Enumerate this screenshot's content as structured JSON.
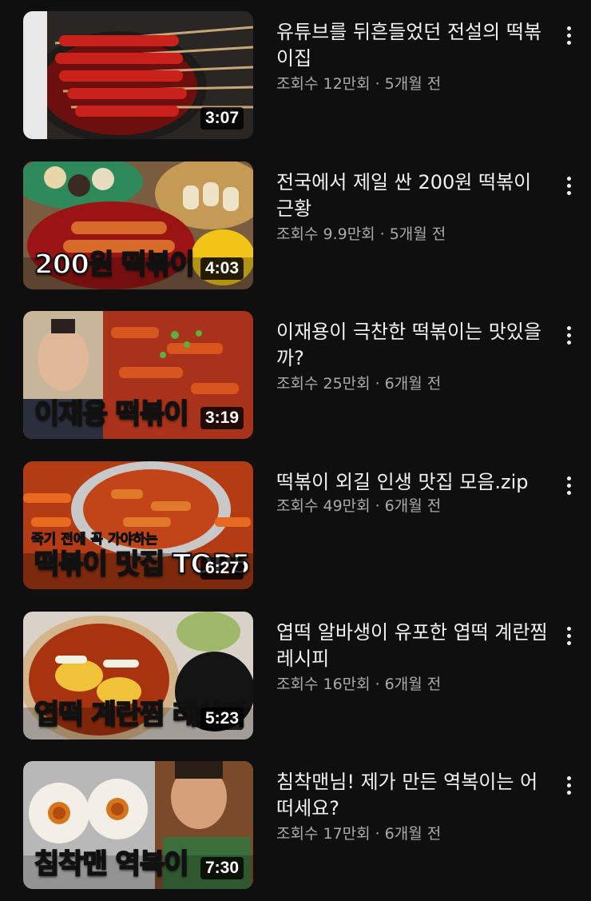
{
  "colors": {
    "background": "#0f0f0f",
    "title_text": "#f1f1f1",
    "meta_text": "#aaaaaa"
  },
  "videos": [
    {
      "title": "유튜브를 뒤흔들었던 전설의 떡볶이집",
      "views": "조회수 12만회",
      "age": "5개월 전",
      "duration": "3:07",
      "thumbnail_text": "",
      "menu_icon": "more-vert-icon"
    },
    {
      "title": "전국에서 제일 싼 200원 떡볶이 근황",
      "views": "조회수 9.9만회",
      "age": "5개월 전",
      "duration": "4:03",
      "thumbnail_text": "200원 떡볶이",
      "menu_icon": "more-vert-icon"
    },
    {
      "title": "이재용이 극찬한 떡볶이는 맛있을까?",
      "views": "조회수 25만회",
      "age": "6개월 전",
      "duration": "3:19",
      "thumbnail_text": "이재용 떡볶이",
      "menu_icon": "more-vert-icon"
    },
    {
      "title": "떡볶이 외길 인생 맛집 모음.zip",
      "views": "조회수 49만회",
      "age": "6개월 전",
      "duration": "6:27",
      "thumbnail_text": "떡볶이 맛집 TOP5",
      "thumbnail_subtext": "죽기 전에 꼭 가야하는",
      "menu_icon": "more-vert-icon"
    },
    {
      "title": "엽떡 알바생이 유포한 엽떡 계란찜 레시피",
      "views": "조회수 16만회",
      "age": "6개월 전",
      "duration": "5:23",
      "thumbnail_text": "엽떡 계란찜 레시피",
      "menu_icon": "more-vert-icon"
    },
    {
      "title": "침착맨님! 제가 만든 역복이는 어떠세요?",
      "views": "조회수 17만회",
      "age": "6개월 전",
      "duration": "7:30",
      "thumbnail_text": "침착맨 역복이",
      "menu_icon": "more-vert-icon"
    }
  ]
}
